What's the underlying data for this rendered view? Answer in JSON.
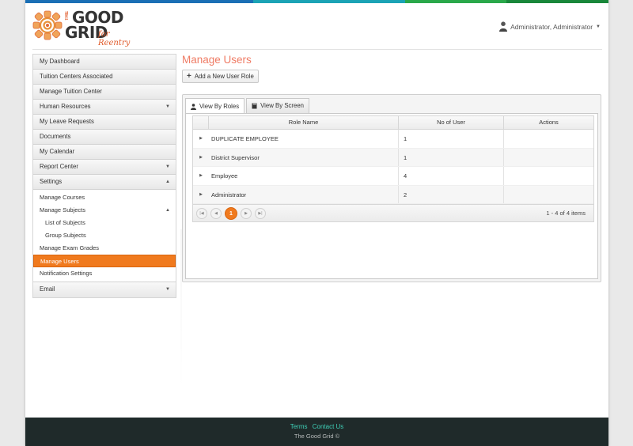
{
  "brand": {
    "the": "THE",
    "good": "GOOD",
    "grid": "GRID",
    "tagline": "for Reentry",
    "colors": {
      "bar1": "#1a73b8",
      "bar2": "#1aa7b8",
      "bar3": "#2aa84a",
      "bar4": "#1e8c3e",
      "accent": "#f07a1e",
      "title": "#ef7b64",
      "footer_link": "#3fd0b8"
    }
  },
  "user": {
    "name": "Administrator, Administrator",
    "icon": "user-icon"
  },
  "sidebar": {
    "items": [
      {
        "label": "My Dashboard"
      },
      {
        "label": "Tuition Centers Associated"
      },
      {
        "label": "Manage Tuition Center"
      },
      {
        "label": "Human Resources",
        "arrow": "▼"
      },
      {
        "label": "My Leave Requests"
      },
      {
        "label": "Documents"
      },
      {
        "label": "My Calendar"
      },
      {
        "label": "Report Center",
        "arrow": "▼"
      },
      {
        "label": "Settings",
        "arrow": "▲"
      }
    ],
    "settings_sub": [
      {
        "label": "Manage Courses"
      },
      {
        "label": "Manage Subjects",
        "arrow": "▲"
      },
      {
        "label": "List of Subjects"
      },
      {
        "label": "Group Subjects"
      },
      {
        "label": "Manage Exam Grades"
      },
      {
        "label": "Manage Users"
      },
      {
        "label": "Notification Settings"
      }
    ],
    "email": {
      "label": "Email",
      "arrow": "▼"
    }
  },
  "main": {
    "title": "Manage Users",
    "add_button": "Add a New User Role",
    "tabs": [
      {
        "label": "View By Roles"
      },
      {
        "label": "View By Screen"
      }
    ],
    "grid": {
      "headers": [
        "Role Name",
        "No of User",
        "Actions"
      ],
      "rows": [
        {
          "role": "DUPLICATE EMPLOYEE",
          "count": "1"
        },
        {
          "role": "District Supervisor",
          "count": "1"
        },
        {
          "role": "Employee",
          "count": "4"
        },
        {
          "role": "Administrator",
          "count": "2"
        }
      ],
      "pager": {
        "current": "1",
        "info": "1 - 4 of 4 items"
      }
    }
  },
  "footer": {
    "terms": "Terms",
    "contact": "Contact Us",
    "copyright": "The Good Grid ©"
  }
}
